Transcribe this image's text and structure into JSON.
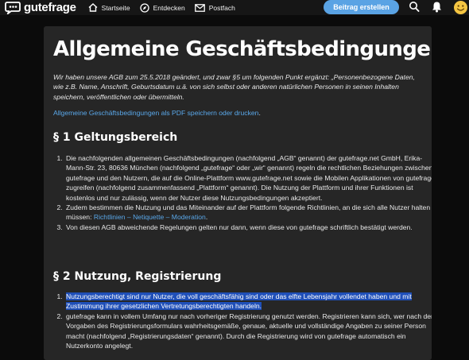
{
  "header": {
    "logo_text": "gutefrage",
    "nav": [
      {
        "label": "Startseite",
        "icon": "home-icon"
      },
      {
        "label": "Entdecken",
        "icon": "compass-icon"
      },
      {
        "label": "Postfach",
        "icon": "mail-icon"
      }
    ],
    "cta_label": "Beitrag erstellen",
    "icons": [
      "search-icon",
      "bell-icon",
      "smiley-avatar-icon"
    ],
    "colors": {
      "cta": "#5aa3e4",
      "bar": "#161616",
      "avatar": "#f4c542"
    }
  },
  "page": {
    "title": "Allgemeine Geschäftsbedingungen",
    "intro": "Wir haben unsere AGB zum 25.5.2018 geändert, und zwar §5 um folgenden Punkt ergänzt: „Personenbezogene Daten, wie z.B. Name, Anschrift, Geburtsdatum u.ä. von sich selbst oder anderen natürlichen Personen in seinen Inhalten speichern, veröffentlichen oder übermitteln.",
    "pdf_link": "Allgemeine Geschäftsbedingungen als PDF speichern oder drucken",
    "pdf_link_suffix": ".",
    "colors": {
      "link": "#5aa8ea",
      "selection": "#1f4fb8",
      "card": "#262626"
    }
  },
  "section1": {
    "heading": "§ 1 Geltungsbereich",
    "items": [
      "Die nachfolgenden allgemeinen Geschäftsbedingungen (nachfolgend „AGB“ genannt) der gutefrage.net GmbH, Erika-Mann-Str. 23, 80636 München (nachfolgend „gutefrage“ oder „wir“ genannt) regeln die rechtlichen Beziehungen zwischen gutefrage und den Nutzern, die auf die Online-Plattform www.gutefrage.net sowie die Mobilen Applikationen von gutefrage zugreifen (nachfolgend zusammenfassend „Plattform“ genannt). Die Nutzung der Plattform und ihrer Funktionen ist kostenlos und nur zulässig, wenn der Nutzer diese Nutzungsbedingungen akzeptiert.",
      "Von diesen AGB abweichende Regelungen gelten nur dann, wenn diese von gutefrage schriftlich bestätigt werden."
    ],
    "item2_prefix": "Zudem bestimmen die Nutzung und das Miteinander auf der Plattform folgende Richtlinien, an die sich alle Nutzer halten müssen: ",
    "item2_link": "Richtlinien – Netiquette – Moderation",
    "item2_suffix": "."
  },
  "section2": {
    "heading": "§ 2 Nutzung, Registrierung",
    "item1_highlighted": "Nutzungsberechtigt sind nur Nutzer, die voll geschäftsfähig sind oder das elfte Lebensjahr vollendet haben und mit Zustimmung ihrer gesetzlichen Vertretungsberechtigten handeln.",
    "item2": "gutefrage kann in vollem Umfang nur nach vorheriger Registrierung genutzt werden. Registrieren kann sich, wer nach den Vorgaben des Registrierungsformulars wahrheitsgemäße, genaue, aktuelle und vollständige Angaben zu seiner Person macht (nachfolgend „Registrierungsdaten“ genannt). Durch die Registrierung wird von gutefrage automatisch ein Nutzerkonto angelegt."
  }
}
